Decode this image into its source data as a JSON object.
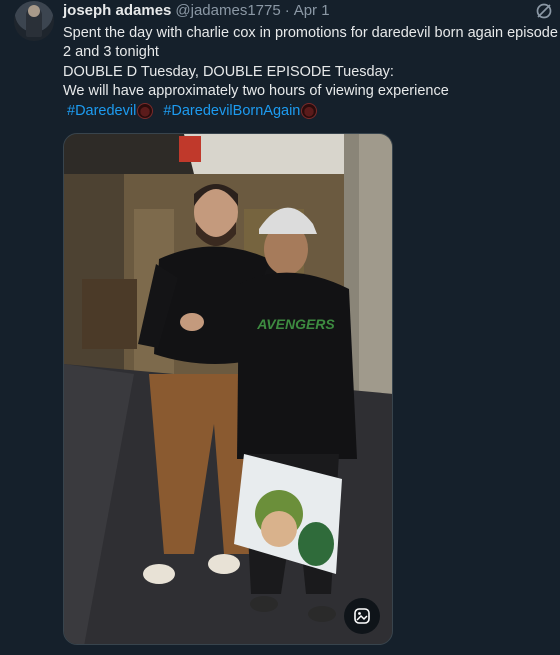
{
  "tweet": {
    "display_name": "joseph adames",
    "handle": "@jadames1775",
    "separator": "·",
    "date": "Apr 1",
    "lines": [
      "Spent the day with charlie cox in promotions for daredevil born again episode",
      "2 and 3 tonight",
      "DOUBLE D Tuesday, DOUBLE EPISODE Tuesday:",
      "We will have approximately two hours of viewing experience"
    ],
    "hashtags": [
      "#Daredevil",
      "#DaredevilBornAgain"
    ],
    "emoji": "daredevil-emoji",
    "icons": {
      "avatar": "user-avatar",
      "grok": "grok-icon",
      "alt": "image-edit-icon"
    },
    "photo": {
      "description_icon": "photo",
      "shirt_text": "AVENGERS"
    }
  },
  "colors": {
    "background": "#15202b",
    "text": "#e7e9ea",
    "muted": "#8b98a5",
    "link": "#1d9bf0"
  }
}
